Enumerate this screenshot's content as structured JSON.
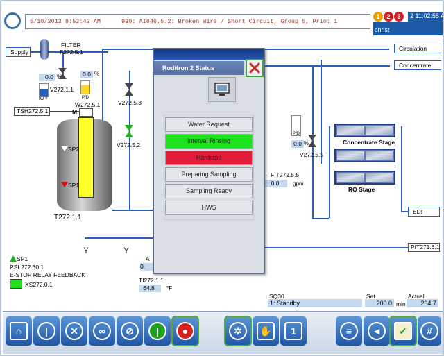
{
  "header": {
    "alarm_timestamp": "5/10/2012 8:52:43 AM",
    "alarm_message": "930: AI846.5.2: Broken Wire / Short Circuit, Group 5, Prio: 1",
    "alarm_counts": [
      "1",
      "2",
      "3"
    ],
    "clock": "2 11:02:55 AM",
    "user": "christ"
  },
  "process": {
    "supply_label": "Supply",
    "filter_label": "FILTER",
    "filter_tag": "F272.5.1",
    "valve_v1_pct": "0.0",
    "valve_v1_unit": "%",
    "valve_v2_pct": "0.0",
    "valve_v2_unit": "%",
    "v2721_tag": "V272.1.1",
    "iw_label": "IW Y",
    "pd_label": "P/D",
    "w2725_tag": "W272.5.1",
    "tsh_tag": "TSH272.5.1",
    "m_label": "M",
    "sp2_label": "SP2",
    "sp1_label": "SP1",
    "v2725_3_tag": "V272.5.3",
    "v2725_2_tag": "V272.5.2",
    "tank_tag": "T272.1.1",
    "circulation_label": "Circulation",
    "concentrate_label": "Concentrate",
    "pd2_label": "P/D",
    "v2725_5_pct": "0.0",
    "v2725_5_unit": "%",
    "v2725_5_tag": "V272.5.5",
    "concentrate_stage_label": "Concentrate Stage",
    "ro_stage_label": "RO Stage",
    "fit_tag": "FIT272.5.5",
    "fit_value": "0.0",
    "fit_unit": "gpm",
    "edi_label": "EDI",
    "pit_tag": "PIT271.6.1",
    "sp1_legend": "SP1",
    "psl_tag": "PSL272.30.1",
    "estop_label": "E-STOP RELAY FEEDBACK",
    "xs_tag": "XS272.0.1",
    "ti_tag": "TI272.1.1",
    "ti_value": "64.8",
    "ti_unit": "°F",
    "hidden_a_label": "A",
    "hidden_a_value": "0."
  },
  "popup": {
    "title": "Roditron 2 Status",
    "states": [
      {
        "label": "Water Request",
        "status": "normal"
      },
      {
        "label": "Interval Rinsing",
        "status": "active"
      },
      {
        "label": "Hardstop",
        "status": "alarm"
      },
      {
        "label": "Preparing Sampling",
        "status": "normal"
      },
      {
        "label": "Sampling Ready",
        "status": "normal"
      },
      {
        "label": "HWS",
        "status": "normal"
      }
    ]
  },
  "info": {
    "sq_label": "SQ30",
    "sq_value": "1: Standby",
    "set_label": "Set",
    "set_value": "200.0",
    "set_unit": "min",
    "actual_label": "Actual",
    "actual_value": "264.7"
  },
  "colors": {
    "pipe": "#2b5fb5",
    "active": "#1ee21e",
    "alarm": "#e21c39",
    "toolbar_button": "#2e6fbf"
  },
  "toolbar": {
    "icons": [
      "home-icon",
      "power-icon",
      "service-tools-icon",
      "link-icon",
      "no-tools-icon",
      "start-icon",
      "stop-icon",
      "settings-gear-icon",
      "manual-hand-icon",
      "step-one-icon",
      "list-menu-icon",
      "sound-icon",
      "checklist-icon",
      "grid-icon"
    ]
  }
}
